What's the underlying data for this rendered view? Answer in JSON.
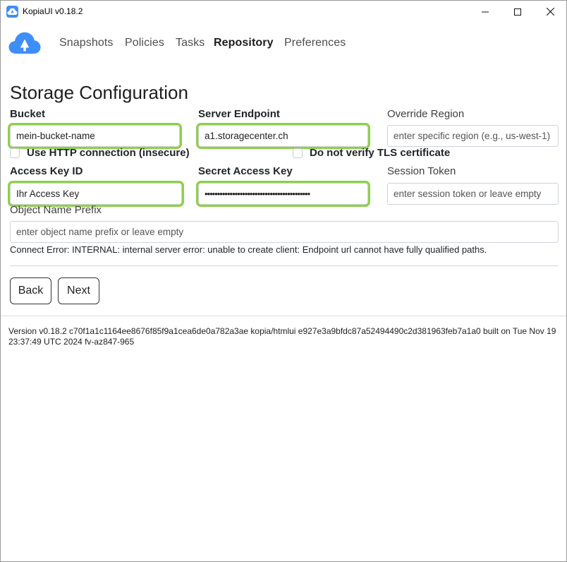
{
  "window": {
    "title": "KopiaUI v0.18.2",
    "controls": [
      "minimize",
      "maximize",
      "close"
    ]
  },
  "nav": {
    "items": [
      {
        "label": "Snapshots",
        "active": false
      },
      {
        "label": "Policies",
        "active": false
      },
      {
        "label": "Tasks",
        "active": false
      },
      {
        "label": "Repository",
        "active": true
      },
      {
        "label": "Preferences",
        "active": false
      }
    ]
  },
  "page": {
    "title": "Storage Configuration"
  },
  "form": {
    "bucket": {
      "label": "Bucket",
      "value": "mein-bucket-name"
    },
    "endpoint": {
      "label": "Server Endpoint",
      "value": "a1.storagecenter.ch"
    },
    "region": {
      "label": "Override Region",
      "placeholder": "enter specific region (e.g., us-west-1)"
    },
    "use_http": {
      "label": "Use HTTP connection (insecure)",
      "checked": false
    },
    "no_verify_tls": {
      "label": "Do not verify TLS certificate",
      "checked": false
    },
    "access_key": {
      "label": "Access Key ID",
      "value": "Ihr Access Key"
    },
    "secret_key": {
      "label": "Secret Access Key",
      "value": "••••••••••••••••••••••••••••••••••••••••••"
    },
    "session_token": {
      "label": "Session Token",
      "placeholder": "enter session token or leave empty"
    },
    "prefix": {
      "label": "Object Name Prefix",
      "placeholder": "enter object name prefix or leave empty"
    }
  },
  "error": "Connect Error: INTERNAL: internal server error: unable to create client: Endpoint url cannot have fully qualified paths.",
  "buttons": {
    "back": "Back",
    "next": "Next"
  },
  "footer": {
    "version": "Version v0.18.2 c70f1a1c1164ee8676f85f9a1cea6de0a782a3ae kopia/htmlui e927e3a9bfdc87a52494490c2d381963feb7a1a0 built on Tue Nov 19 23:37:49 UTC 2024 fv-az847-965"
  },
  "colors": {
    "highlight": "#8dd14a",
    "logo": "#3e8ef7"
  }
}
